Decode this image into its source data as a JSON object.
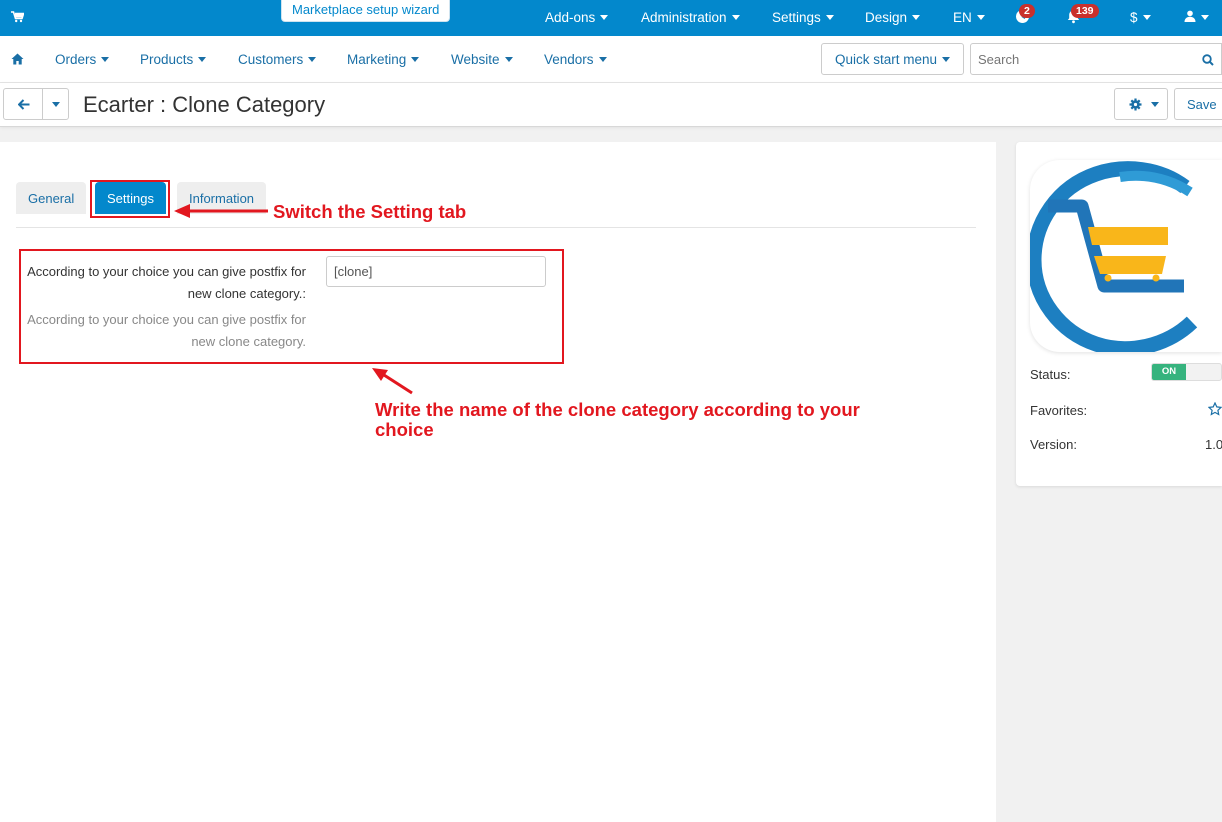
{
  "topbar": {
    "wizard_label": "Marketplace setup wizard",
    "menu": {
      "addons": "Add-ons",
      "administration": "Administration",
      "settings": "Settings",
      "design": "Design",
      "language": "EN",
      "currency": "$"
    },
    "news_count": "2",
    "notification_count": "139",
    "accent_color": "#0388cc"
  },
  "mainnav": {
    "orders": "Orders",
    "products": "Products",
    "customers": "Customers",
    "marketing": "Marketing",
    "website": "Website",
    "vendors": "Vendors",
    "quick_start": "Quick start menu",
    "search_placeholder": "Search"
  },
  "header": {
    "title": "Ecarter : Clone Category",
    "save_label": "Save"
  },
  "tabs": [
    {
      "label": "General"
    },
    {
      "label": "Settings"
    },
    {
      "label": "Information"
    }
  ],
  "form": {
    "label": "According to your choice you can give postfix for new clone category.:",
    "help": "According to your choice you can give postfix for new clone category.",
    "value": "[clone]"
  },
  "annotations": {
    "tab_note": "Switch the Setting tab",
    "field_note": "Write the name of the clone category according to your choice",
    "color": "#e2171f"
  },
  "sidebar": {
    "status_label": "Status:",
    "status_value": "ON",
    "favorites_label": "Favorites:",
    "version_label": "Version:",
    "version_value": "1.0"
  }
}
